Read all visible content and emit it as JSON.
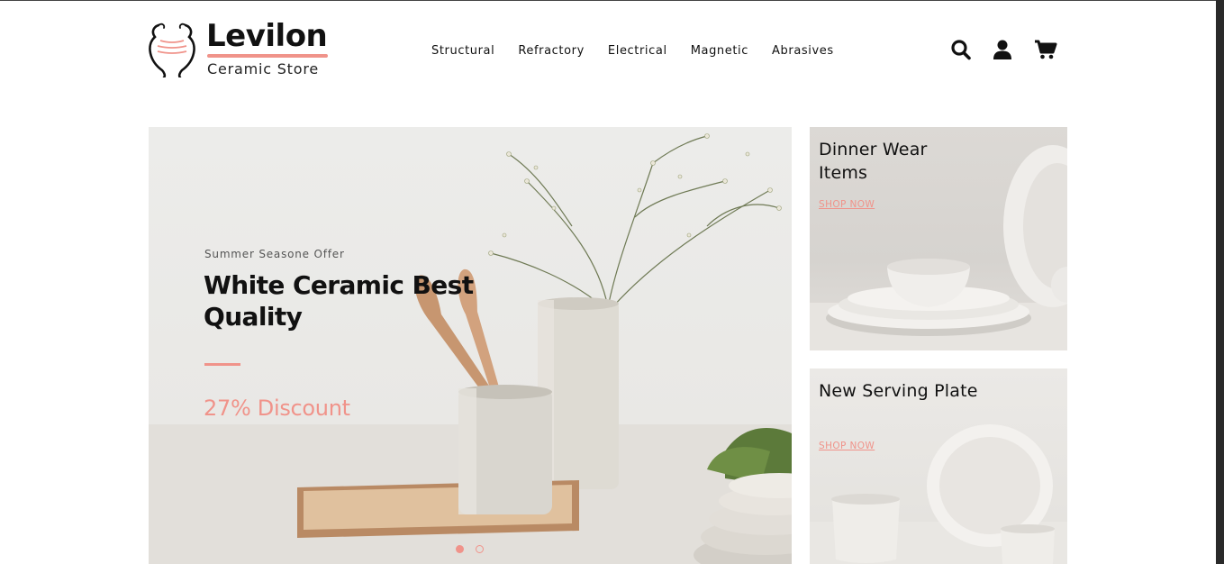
{
  "brand": {
    "name": "Levilon",
    "tagline": "Ceramic Store",
    "accent_color": "#f0938a"
  },
  "nav": {
    "items": [
      "Structural",
      "Refractory",
      "Electrical",
      "Magnetic",
      "Abrasives"
    ]
  },
  "header_icons": [
    "search-icon",
    "user-icon",
    "cart-icon"
  ],
  "hero": {
    "subtitle": "Summer Seasone Offer",
    "title": "White Ceramic Best Quality",
    "discount": "27% Discount",
    "slides": 2,
    "active_slide": 1
  },
  "banners": [
    {
      "title": "Dinner Wear Items",
      "link": "SHOP NOW"
    },
    {
      "title": "New Serving Plate",
      "link": "SHOP NOW"
    }
  ]
}
